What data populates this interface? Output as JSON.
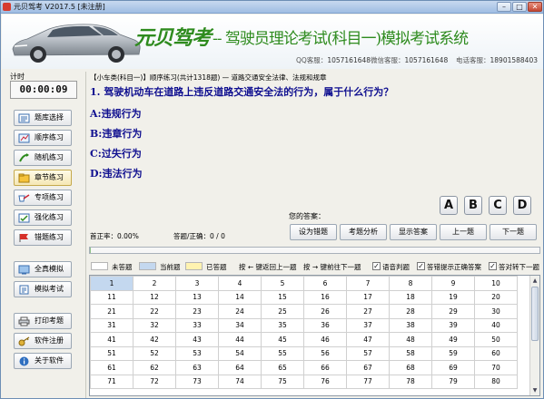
{
  "window": {
    "title": "元贝驾考 V2017.5 [未注册]",
    "min_glyph": "–",
    "max_glyph": "□",
    "close_glyph": "✕"
  },
  "header": {
    "logo": "元贝驾考",
    "slogan": "-- 驾驶员理论考试(科目一)模拟考试系统",
    "qq_label": "QQ客服：",
    "qq": "1057161648",
    "wechat_label": "微信客服：",
    "wechat": "1057161648",
    "phone_label": "电话客服：",
    "phone": "18901588403"
  },
  "sidebar": {
    "timer_label": "计时",
    "timer": "00:00:09",
    "items": [
      {
        "label": "题库选择",
        "icon": "question-bank-icon"
      },
      {
        "label": "顺序练习",
        "icon": "sequence-icon"
      },
      {
        "label": "随机练习",
        "icon": "random-icon"
      },
      {
        "label": "章节练习",
        "icon": "chapter-icon"
      },
      {
        "label": "专项练习",
        "icon": "special-icon"
      },
      {
        "label": "强化练习",
        "icon": "intensive-icon"
      },
      {
        "label": "错题练习",
        "icon": "wrong-question-icon"
      },
      {
        "label": "全真模拟",
        "icon": "full-simulation-icon"
      },
      {
        "label": "模拟考试",
        "icon": "mock-exam-icon"
      },
      {
        "label": "打印考题",
        "icon": "printer-icon"
      },
      {
        "label": "软件注册",
        "icon": "register-icon"
      },
      {
        "label": "关于软件",
        "icon": "info-icon"
      }
    ],
    "active_index": 3
  },
  "main": {
    "breadcrumb": "【小车类(科目一)】顺序练习(共计1318题) — 道路交通安全法律、法规和规章",
    "question": "1. 驾驶机动车在道路上违反道路交通安全法的行为，属于什么行为？",
    "options": [
      "A:违规行为",
      "B:违章行为",
      "C:过失行为",
      "D:违法行为"
    ],
    "answer_label": "您的答案：",
    "choices": [
      "A",
      "B",
      "C",
      "D"
    ],
    "accuracy": "首正率：0.00%",
    "correct_ratio": "答题/正确：0 / 0",
    "actions": [
      "设为错题",
      "考题分析",
      "显示答案",
      "上一题",
      "下一题"
    ],
    "progress": 0.003
  },
  "legend": {
    "unanswered": "未答题",
    "current": "当前题",
    "answered": "已答题",
    "key_prev": "按 ← 键返回上一题",
    "key_next": "按 → 键前往下一题",
    "voice": "语音判题",
    "show_correct": "答错提示正确答案",
    "auto_next": "答对转下一题",
    "colors": {
      "unanswered": "#ffffff",
      "current": "#c4d8ef",
      "answered": "#fff3b0"
    }
  },
  "grid": {
    "rows": [
      [
        "1",
        "2",
        "3",
        "4",
        "5",
        "6",
        "7",
        "8",
        "9",
        "10"
      ],
      [
        "11",
        "12",
        "13",
        "14",
        "15",
        "16",
        "17",
        "18",
        "19",
        "20"
      ],
      [
        "21",
        "22",
        "23",
        "24",
        "25",
        "26",
        "27",
        "28",
        "29",
        "30"
      ],
      [
        "31",
        "32",
        "33",
        "34",
        "35",
        "36",
        "37",
        "38",
        "39",
        "40"
      ],
      [
        "41",
        "42",
        "43",
        "44",
        "45",
        "46",
        "47",
        "48",
        "49",
        "50"
      ],
      [
        "51",
        "52",
        "53",
        "54",
        "55",
        "56",
        "57",
        "58",
        "59",
        "60"
      ],
      [
        "61",
        "62",
        "63",
        "64",
        "65",
        "66",
        "67",
        "68",
        "69",
        "70"
      ],
      [
        "71",
        "72",
        "73",
        "74",
        "75",
        "76",
        "77",
        "78",
        "79",
        "80"
      ]
    ],
    "current": "1"
  }
}
